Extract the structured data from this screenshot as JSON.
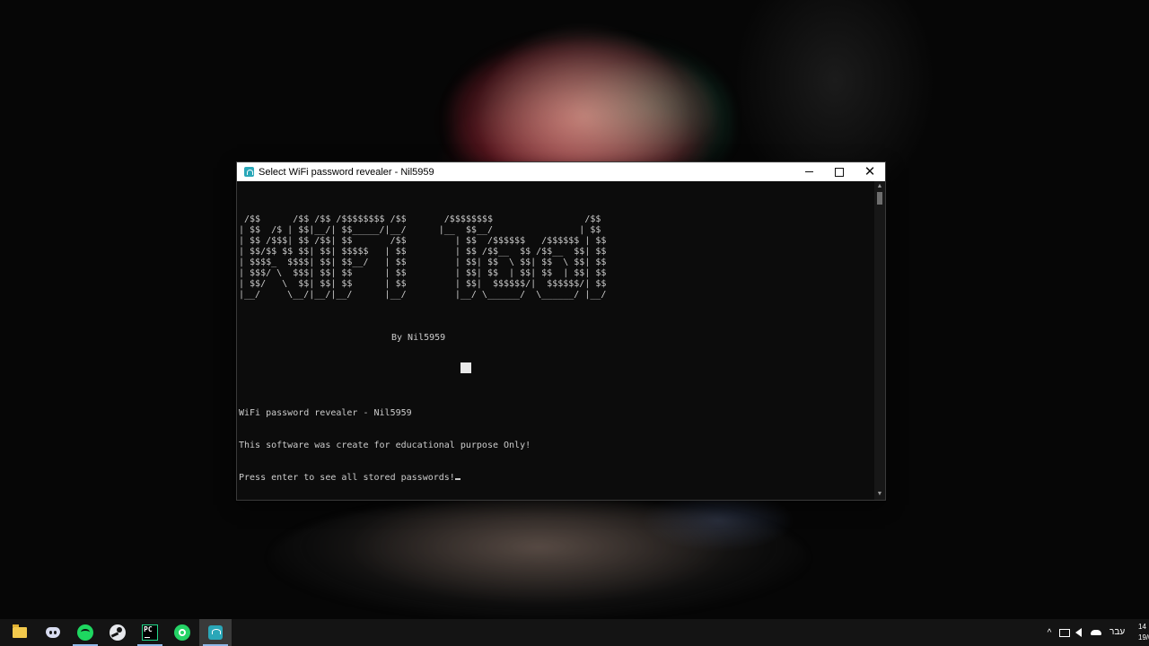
{
  "window": {
    "title": "Select WiFi password revealer - Nil5959"
  },
  "console": {
    "ascii_banner": " /$$      /$$ /$$ /$$$$$$$$ /$$       /$$$$$$$$                 /$$\n| $$  /$ | $$|__/| $$_____/|__/      |__  $$__/                | $$\n| $$ /$$$| $$ /$$| $$       /$$         | $$  /$$$$$$   /$$$$$$ | $$\n| $$/$$ $$ $$| $$| $$$$$   | $$         | $$ /$$__  $$ /$$__  $$| $$\n| $$$$_  $$$$| $$| $$__/   | $$         | $$| $$  \\ $$| $$  \\ $$| $$\n| $$$/ \\  $$$| $$| $$      | $$         | $$| $$  | $$| $$  | $$| $$\n| $$/   \\  $$| $$| $$      | $$         | $$|  $$$$$$/|  $$$$$$/| $$\n|__/     \\__/|__/|__/      |__/         |__/ \\______/  \\______/ |__/",
    "author_line": "By Nil5959",
    "lines": [
      "WiFi password revealer - Nil5959",
      "This software was create for educational purpose Only!",
      "Press enter to see all stored passwords!"
    ]
  },
  "taskbar": {
    "apps": [
      {
        "name": "file-explorer-icon"
      },
      {
        "name": "discord-icon"
      },
      {
        "name": "spotify-icon"
      },
      {
        "name": "steam-icon"
      },
      {
        "name": "pycharm-icon",
        "glyph": "PC"
      },
      {
        "name": "whatsapp-icon"
      },
      {
        "name": "wifi-revealer-app-icon"
      }
    ],
    "tray": {
      "chevron": "^",
      "language": "עבר",
      "time": "14",
      "date": "19/0"
    }
  },
  "colors": {
    "console_bg": "#0c0c0c",
    "console_text": "#cccccc",
    "title_bar": "#ffffff",
    "taskbar": "#141414",
    "active_indicator": "#8fb8e8"
  }
}
